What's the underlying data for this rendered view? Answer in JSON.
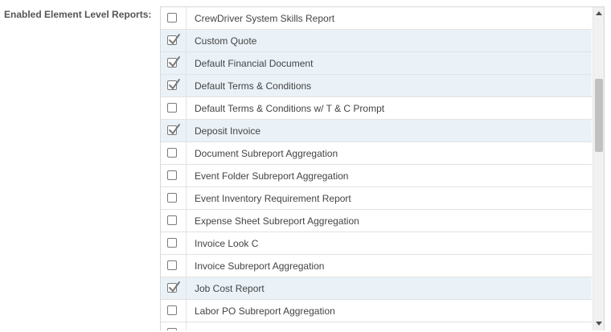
{
  "field": {
    "label": "Enabled Element Level Reports:"
  },
  "reports": [
    {
      "label": "CrewDriver System Skills Report",
      "checked": false
    },
    {
      "label": "Custom Quote",
      "checked": true
    },
    {
      "label": "Default Financial Document",
      "checked": true
    },
    {
      "label": "Default Terms & Conditions",
      "checked": true
    },
    {
      "label": "Default Terms & Conditions w/ T & C Prompt",
      "checked": false
    },
    {
      "label": "Deposit Invoice",
      "checked": true
    },
    {
      "label": "Document Subreport Aggregation",
      "checked": false
    },
    {
      "label": "Event Folder Subreport Aggregation",
      "checked": false
    },
    {
      "label": "Event Inventory Requirement Report",
      "checked": false
    },
    {
      "label": "Expense Sheet Subreport Aggregation",
      "checked": false
    },
    {
      "label": "Invoice Look C",
      "checked": false
    },
    {
      "label": "Invoice Subreport Aggregation",
      "checked": false
    },
    {
      "label": "Job Cost Report",
      "checked": true
    },
    {
      "label": "Labor PO Subreport Aggregation",
      "checked": false
    },
    {
      "label": "",
      "checked": false
    }
  ],
  "icons": {
    "checkmark": "check-icon",
    "scroll_up": "triangle-up-icon",
    "scroll_down": "triangle-down-icon"
  },
  "colors": {
    "checked_row_bg": "#eaf2f8",
    "checkbox_border": "#7a7a7a",
    "checkmark": "#7a7a7a"
  }
}
